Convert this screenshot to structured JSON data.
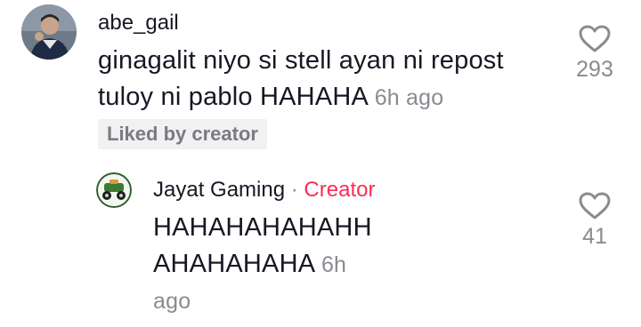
{
  "comments": [
    {
      "username": "abe_gail",
      "text_line1": "ginagalit niyo si stell ayan ni repost",
      "text_line2": "tuloy ni pablo HAHAHA",
      "time": "6h ago",
      "badge": "Liked by creator",
      "likes": "293",
      "icons": {
        "avatar": "user-avatar",
        "like": "heart-outline-icon"
      }
    },
    {
      "username": "Jayat Gaming",
      "separator": "·",
      "creator_label": "Creator",
      "text_line1": "HAHAHAHAHAHH",
      "text_line2": "AHAHAHAHA",
      "time_part1": "6h",
      "time_part2": "ago",
      "likes": "41",
      "icons": {
        "avatar": "creator-avatar",
        "like": "heart-outline-icon"
      }
    }
  ],
  "colors": {
    "text": "#161823",
    "muted": "#8a8b91",
    "creator_accent": "#fe2c55",
    "badge_bg": "#f1f1f2"
  }
}
